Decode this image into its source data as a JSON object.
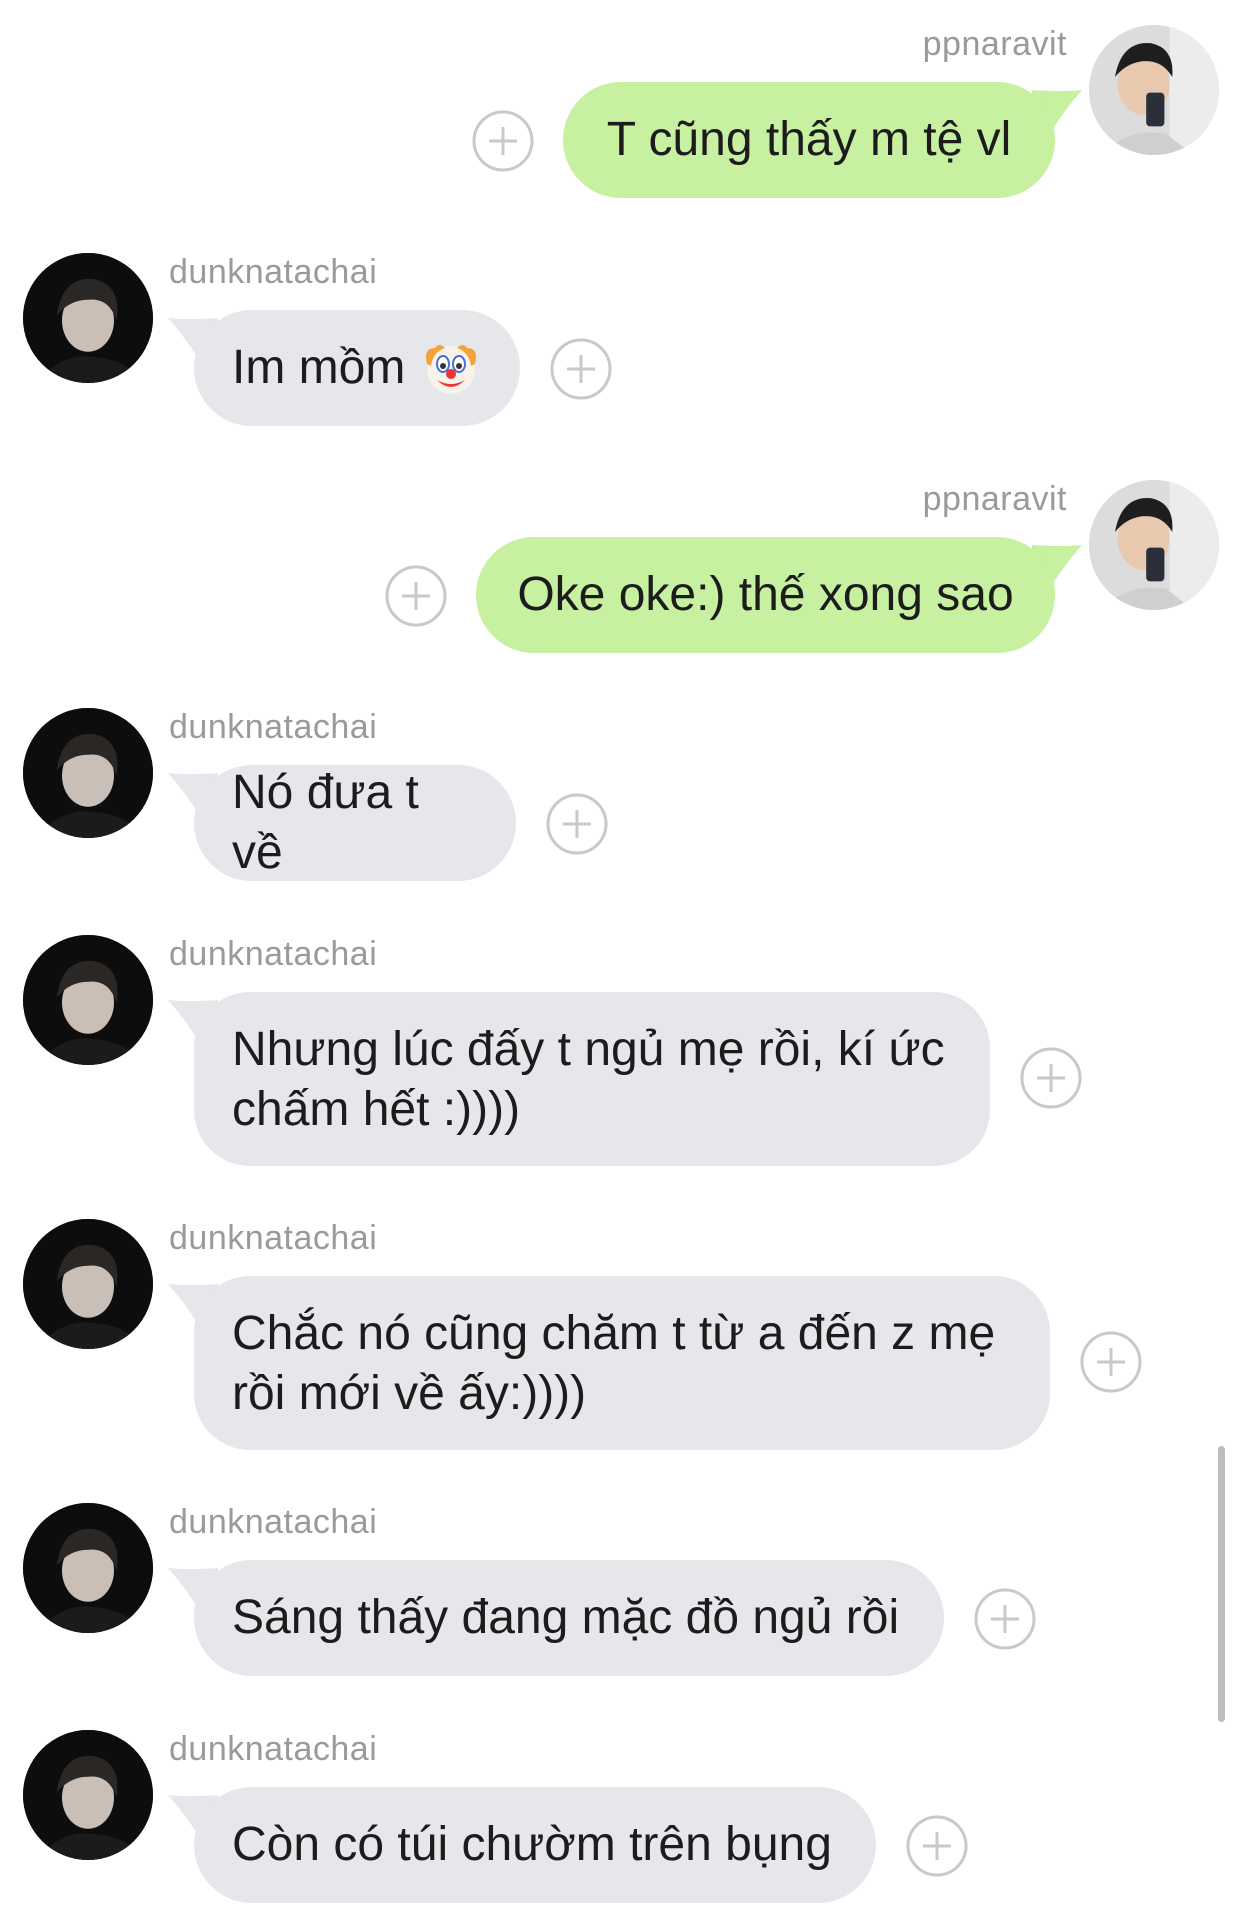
{
  "users": {
    "me": "ppnaravit",
    "other": "dunknatachai"
  },
  "messages": [
    {
      "sender": "ppnaravit",
      "text": "T cũng thấy m tệ vl"
    },
    {
      "sender": "dunknatachai",
      "text": "Im mồm"
    },
    {
      "sender": "ppnaravit",
      "text": "Oke oke:) thế xong sao"
    },
    {
      "sender": "dunknatachai",
      "text": "Nó đưa t về"
    },
    {
      "sender": "dunknatachai",
      "text": "Nhưng lúc đấy t ngủ mẹ rồi, kí ức chấm hết :))))"
    },
    {
      "sender": "dunknatachai",
      "text": "Chắc nó cũng chăm t từ a đến z mẹ rồi mới về ấy:))))"
    },
    {
      "sender": "dunknatachai",
      "text": "Sáng thấy đang mặc đồ ngủ rồi"
    },
    {
      "sender": "dunknatachai",
      "text": "Còn có túi chườm trên bụng"
    }
  ],
  "icons": {
    "add_reaction": "plus-circle-icon",
    "clown": "clown-face-emoji"
  },
  "colors": {
    "outgoing_bubble": "#c7f0a1",
    "incoming_bubble": "#e5e7ea",
    "username": "#9a9a9a"
  }
}
